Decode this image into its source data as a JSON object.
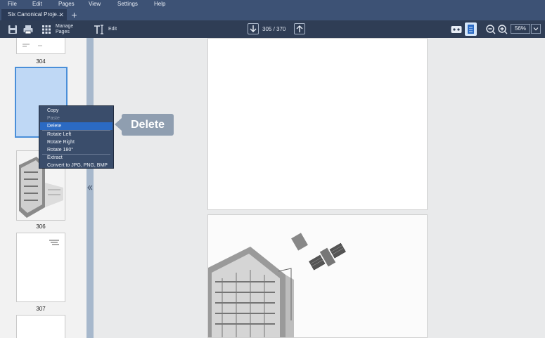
{
  "menu": [
    "File",
    "Edit",
    "Pages",
    "View",
    "Settings",
    "Help"
  ],
  "tab": {
    "title": "Six Canonical Proje...",
    "close": "✕",
    "add": "+"
  },
  "toolbar": {
    "manage_pages": "Manage Pages",
    "edit": "Edit",
    "page_indicator": "305 / 370",
    "zoom": "56%"
  },
  "thumbnails": {
    "page_numbers": [
      "304",
      "306",
      "307"
    ]
  },
  "context_menu": {
    "items": [
      "Copy",
      "Paste",
      "Delete",
      "Rotate Left",
      "Rotate Right",
      "Rotate 180°",
      "Extract",
      "Convert to JPG, PNG, BMP"
    ],
    "disabled": [
      "Paste"
    ],
    "active": "Delete"
  },
  "callout": {
    "label": "Delete"
  },
  "colors": {
    "accent": "#2b6ac3",
    "menubar": "#3d5275",
    "toolbar": "#2f3d55",
    "selection": "#bfd8f5"
  },
  "icons": [
    "save-icon",
    "print-icon",
    "grid-icon",
    "text-cursor-icon",
    "arrow-down-icon",
    "arrow-up-icon",
    "view-mode-icon",
    "page-layout-icon",
    "zoom-out-icon",
    "zoom-in-icon",
    "chevron-down-icon",
    "chevron-left-icon"
  ]
}
